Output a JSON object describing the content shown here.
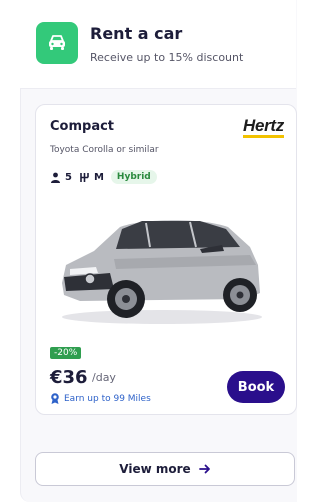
{
  "header": {
    "title": "Rent a car",
    "subtitle": "Receive up to 15% discount",
    "icon": "car-icon",
    "icon_bg": "#33c97a"
  },
  "card": {
    "car_class": "Compact",
    "brand": "Hertz",
    "model": "Toyota Corolla or similar",
    "specs": {
      "seats": "5",
      "transmission": "M",
      "fuel_badge": "Hybrid"
    },
    "discount": "-20%",
    "price": "€36",
    "per_day": "/day",
    "miles": "Earn up to 99 Miles",
    "book_label": "Book",
    "accent_color": "#2a0f8c"
  },
  "footer": {
    "view_more_label": "View more"
  }
}
